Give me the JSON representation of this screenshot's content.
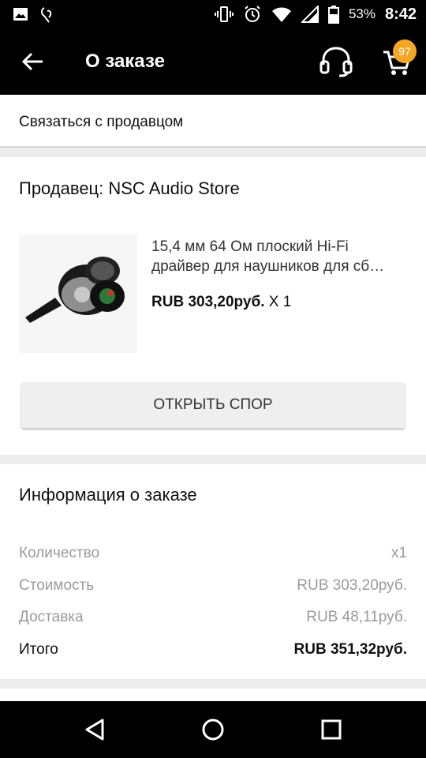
{
  "status_bar": {
    "battery": "53%",
    "time": "8:42"
  },
  "app_bar": {
    "title": "О заказе",
    "cart_count": "97"
  },
  "contact": {
    "label": "Связаться с продавцом"
  },
  "seller": {
    "label": "Продавец: NSC Audio Store",
    "product": {
      "name_line1": "15,4 мм 64 Ом плоский Hi-Fi",
      "name_line2": "драйвер для наушников для сб…",
      "price": "RUB 303,20руб.",
      "quantity": "X 1"
    },
    "dispute_button": "ОТКРЫТЬ СПОР"
  },
  "order_info": {
    "heading": "Информация о заказе",
    "rows": [
      {
        "label": "Количество",
        "value": "x1"
      },
      {
        "label": "Стоимость",
        "value": "RUB 303,20руб."
      },
      {
        "label": "Доставка",
        "value": "RUB 48,11руб."
      }
    ],
    "total": {
      "label": "Итого",
      "value": "RUB 351,32руб."
    }
  },
  "colors": {
    "bar": "#000000",
    "badge": "#f5a623",
    "background": "#ececec"
  }
}
